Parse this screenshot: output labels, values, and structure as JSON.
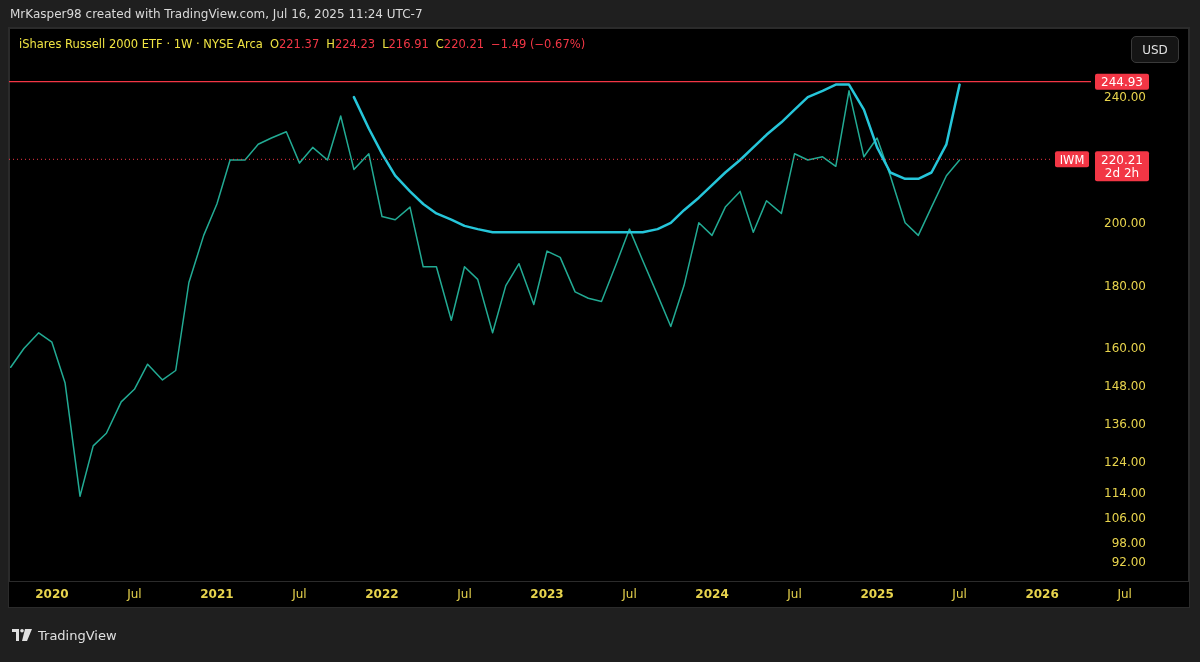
{
  "header": {
    "caption": "MrKasper98 created with TradingView.com, Jul 16, 2025 11:24 UTC-7"
  },
  "legend": {
    "title": "iShares Russell 2000 ETF · 1W · NYSE Arca",
    "ohlc": [
      {
        "key": "O",
        "value": "221.37"
      },
      {
        "key": "H",
        "value": "224.23"
      },
      {
        "key": "L",
        "value": "216.91"
      },
      {
        "key": "C",
        "value": "220.21"
      }
    ],
    "change": "−1.49 (−0.67%)"
  },
  "currency_button": {
    "label": "USD"
  },
  "chart": {
    "chart_data": {
      "type": "line",
      "x": [
        2019.75,
        2019.83,
        2019.92,
        2020.0,
        2020.08,
        2020.17,
        2020.25,
        2020.33,
        2020.42,
        2020.5,
        2020.58,
        2020.67,
        2020.75,
        2020.83,
        2020.92,
        2021.0,
        2021.08,
        2021.17,
        2021.25,
        2021.33,
        2021.42,
        2021.5,
        2021.58,
        2021.67,
        2021.75,
        2021.83,
        2021.92,
        2022.0,
        2022.08,
        2022.17,
        2022.25,
        2022.33,
        2022.42,
        2022.5,
        2022.58,
        2022.67,
        2022.75,
        2022.83,
        2022.92,
        2023.0,
        2023.08,
        2023.17,
        2023.25,
        2023.33,
        2023.42,
        2023.5,
        2023.58,
        2023.67,
        2023.75,
        2023.83,
        2023.92,
        2024.0,
        2024.08,
        2024.17,
        2024.25,
        2024.33,
        2024.42,
        2024.5,
        2024.58,
        2024.67,
        2024.75,
        2024.83,
        2024.92,
        2025.0,
        2025.08,
        2025.17,
        2025.25,
        2025.33,
        2025.42,
        2025.5
      ],
      "series": [
        {
          "name": "IWM",
          "color": "#22ab94",
          "values": [
            154,
            160,
            165,
            162,
            149,
            113,
            129,
            133,
            143,
            147,
            155,
            150,
            153,
            181,
            196,
            206,
            220,
            220,
            225,
            227,
            229,
            219,
            224,
            220,
            234,
            217,
            222,
            202,
            201,
            205,
            186,
            186,
            169,
            186,
            182,
            165,
            180,
            187,
            174,
            191,
            189,
            178,
            176,
            175,
            187,
            198,
            188,
            177,
            167,
            180,
            200,
            196,
            205,
            210,
            197,
            207,
            203,
            222,
            220,
            221,
            218,
            242,
            221,
            227,
            215,
            200,
            196,
            205,
            215,
            220
          ]
        },
        {
          "color": "#26c6da",
          "values": [
            null,
            null,
            null,
            null,
            null,
            null,
            null,
            null,
            null,
            null,
            null,
            null,
            null,
            null,
            null,
            null,
            null,
            null,
            null,
            null,
            null,
            null,
            null,
            null,
            null,
            240,
            230,
            222,
            215,
            210,
            206,
            203,
            201,
            199,
            198,
            197,
            197,
            197,
            197,
            197,
            197,
            197,
            197,
            197,
            197,
            197,
            197,
            198,
            200,
            204,
            208,
            212,
            216,
            220,
            224,
            228,
            232,
            236,
            240,
            242,
            244,
            244,
            236,
            224,
            216,
            214,
            214,
            216,
            225,
            244
          ]
        }
      ],
      "xlim": [
        2019.74,
        2026.89
      ],
      "ylim": [
        86,
        262
      ],
      "ref_lines": [
        {
          "axis": "y",
          "value": 244.93,
          "label": "244.93"
        }
      ],
      "yticks": [
        {
          "value": 240,
          "label": "240.00"
        },
        {
          "value": 200,
          "label": "200.00"
        },
        {
          "value": 180,
          "label": "180.00"
        },
        {
          "value": 160,
          "label": "160.00"
        },
        {
          "value": 148,
          "label": "148.00"
        },
        {
          "value": 136,
          "label": "136.00"
        },
        {
          "value": 124,
          "label": "124.00"
        },
        {
          "value": 114,
          "label": "114.00"
        },
        {
          "value": 106,
          "label": "106.00"
        },
        {
          "value": 98,
          "label": "98.00"
        },
        {
          "value": 92,
          "label": "92.00"
        }
      ],
      "xticks": [
        {
          "value": 2020,
          "label": "2020"
        },
        {
          "value": 2020.5,
          "label": "Jul"
        },
        {
          "value": 2021,
          "label": "2021"
        },
        {
          "value": 2021.5,
          "label": "Jul"
        },
        {
          "value": 2022,
          "label": "2022"
        },
        {
          "value": 2022.5,
          "label": "Jul"
        },
        {
          "value": 2023,
          "label": "2023"
        },
        {
          "value": 2023.5,
          "label": "Jul"
        },
        {
          "value": 2024,
          "label": "2024"
        },
        {
          "value": 2024.5,
          "label": "Jul"
        },
        {
          "value": 2025,
          "label": "2025"
        },
        {
          "value": 2025.5,
          "label": "Jul"
        },
        {
          "value": 2026,
          "label": "2026"
        },
        {
          "value": 2026.5,
          "label": "Jul"
        }
      ]
    },
    "last_price": {
      "label": "220.21",
      "countdown": "2d 2h"
    }
  },
  "footer": {
    "brand": "TradingView"
  }
}
